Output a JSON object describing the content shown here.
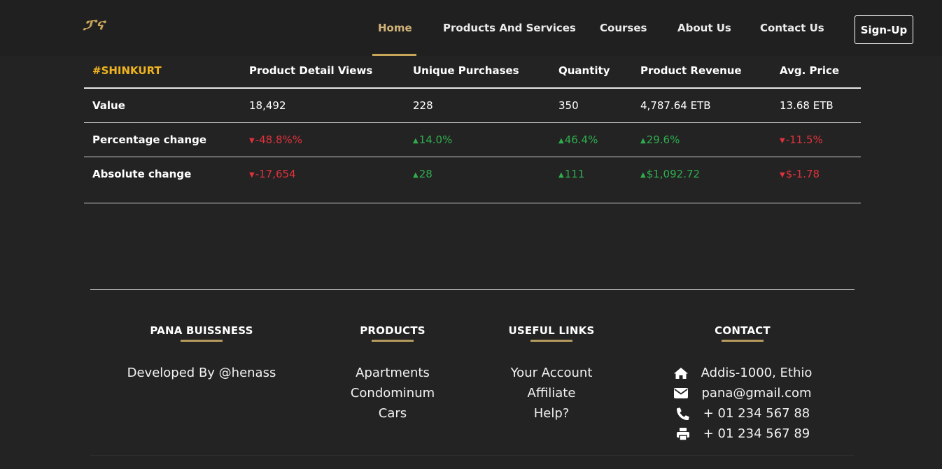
{
  "nav": {
    "logo": "ፓና",
    "links": [
      "Home",
      "Products And Services",
      "Courses",
      "About Us",
      "Contact Us"
    ],
    "signup": "Sign-Up"
  },
  "table": {
    "headers": [
      "#SHINKURT",
      "Product Detail Views",
      "Unique Purchases",
      "Quantity",
      "Product Revenue",
      "Avg. Price"
    ],
    "rows": [
      {
        "label": "Value",
        "cells": [
          "18,492",
          "228",
          "350",
          "4,787.64 ETB",
          "13.68 ETB"
        ],
        "trends": [
          "",
          "",
          "",
          "",
          ""
        ]
      },
      {
        "label": "Percentage change",
        "cells": [
          "-48.8%%",
          "14.0%",
          "46.4%",
          "29.6%",
          "-11.5%"
        ],
        "trends": [
          "down",
          "up",
          "up",
          "up",
          "down"
        ]
      },
      {
        "label": "Absolute change",
        "cells": [
          "-17,654",
          "28",
          "111",
          "$1,092.72",
          "$-1.78"
        ],
        "trends": [
          "down",
          "up",
          "up",
          "up",
          "down"
        ]
      }
    ],
    "colors": {
      "brand": "#f0b320",
      "negative": "#e0323c",
      "positive": "#2fae4e"
    }
  },
  "footer": {
    "pana": {
      "title": "PANA BUISSNESS",
      "items": [
        "Developed By @henass"
      ]
    },
    "products": {
      "title": "PRODUCTS",
      "items": [
        "Apartments",
        "Condominum",
        "Cars"
      ]
    },
    "useful": {
      "title": "USEFUL LINKS",
      "items": [
        "Your Account",
        "Affiliate",
        "Help?"
      ]
    },
    "contact": {
      "title": "CONTACT",
      "items": [
        {
          "icon": "home-icon",
          "text": "Addis-1000, Ethio"
        },
        {
          "icon": "envelope-icon",
          "text": "pana@gmail.com"
        },
        {
          "icon": "phone-icon",
          "text": "+ 01 234 567 88"
        },
        {
          "icon": "print-icon",
          "text": "+ 01 234 567 89"
        }
      ]
    }
  }
}
